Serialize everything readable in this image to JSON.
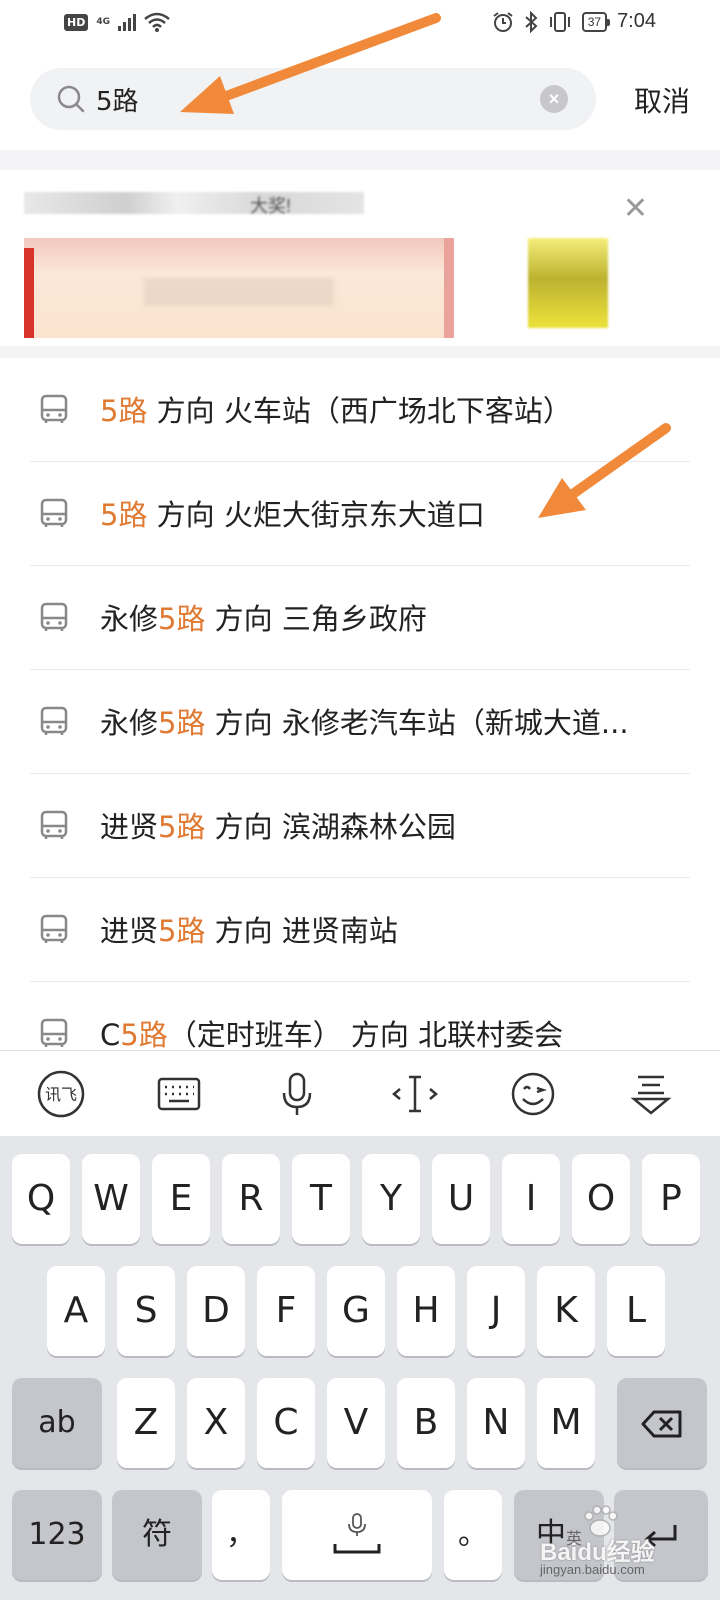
{
  "status_bar": {
    "hd": "HD",
    "network": "4G",
    "battery": "37",
    "time": "7:04"
  },
  "search": {
    "query": "5路",
    "cancel_label": "取消"
  },
  "ad": {
    "text_fragment": "大奖!"
  },
  "results": [
    {
      "prefix": "",
      "route": "5路",
      "direction": " 方向 ",
      "destination": "火车站（西广场北下客站）"
    },
    {
      "prefix": "",
      "route": "5路",
      "direction": " 方向 ",
      "destination": "火炬大街京东大道口"
    },
    {
      "prefix": "永修",
      "route": "5路",
      "direction": " 方向 ",
      "destination": "三角乡政府"
    },
    {
      "prefix": "永修",
      "route": "5路",
      "direction": " 方向 ",
      "destination": "永修老汽车站（新城大道..."
    },
    {
      "prefix": "进贤",
      "route": "5路",
      "direction": " 方向 ",
      "destination": "滨湖森林公园"
    },
    {
      "prefix": "进贤",
      "route": "5路",
      "direction": " 方向 ",
      "destination": "进贤南站"
    },
    {
      "prefix": "C",
      "route": "5路",
      "direction": "（定时班车） 方向 ",
      "destination": "北联村委会"
    }
  ],
  "keyboard": {
    "toolbar_icons": [
      "xunfei-icon",
      "keyboard-icon",
      "microphone-icon",
      "cursor-icon",
      "emoji-icon",
      "collapse-keyboard-icon"
    ],
    "xunfei_label": "讯飞",
    "row1": [
      "Q",
      "W",
      "E",
      "R",
      "T",
      "Y",
      "U",
      "I",
      "O",
      "P"
    ],
    "row2": [
      "A",
      "S",
      "D",
      "F",
      "G",
      "H",
      "J",
      "K",
      "L"
    ],
    "row3": [
      "Z",
      "X",
      "C",
      "V",
      "B",
      "N",
      "M"
    ],
    "ab_label": "ab",
    "num_label": "123",
    "symbol_label": "符",
    "comma_label": "，",
    "period_label": "。",
    "lang_label": "中",
    "lang_sub": "英"
  },
  "watermark": {
    "brand": "Baidu经验",
    "url": "jingyan.baidu.com"
  },
  "colors": {
    "highlight": "#e07a32",
    "arrow": "#f08a3a"
  }
}
